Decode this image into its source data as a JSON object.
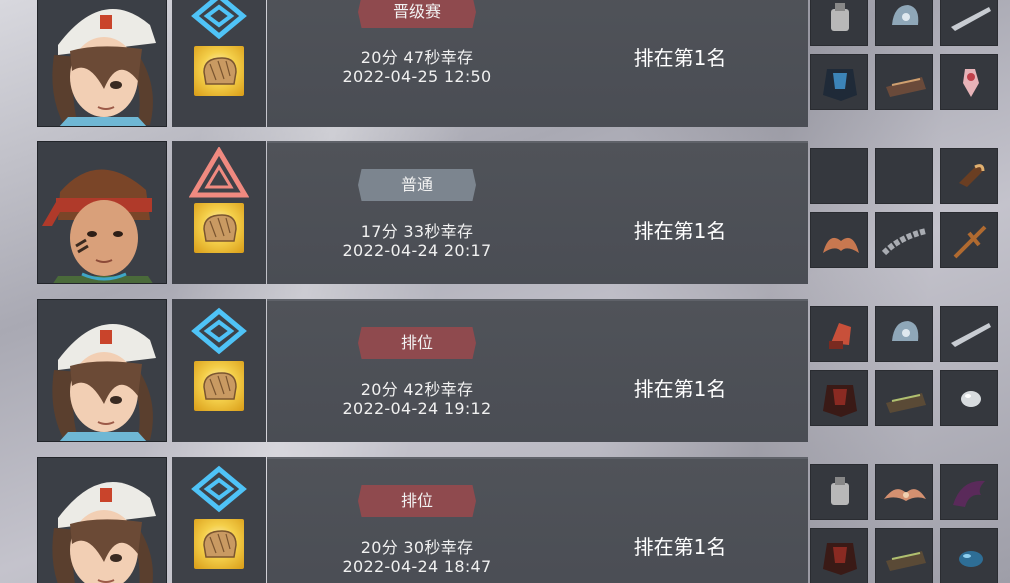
{
  "records": [
    {
      "character": "white-cap-hair-over-eye",
      "mode_icon": "diamond-rank-icon",
      "mode_color": "#4fc3f7",
      "tag": "晋级赛",
      "tag_color": "#8f4a4e",
      "survival": "20分 47秒幸存",
      "date": "2022-04-25 12:50",
      "rank": "排在第1名",
      "items": [
        "glove-icon",
        "helmet-icon",
        "blade-icon",
        "armor-icon",
        "boots-icon",
        "trinket-icon"
      ]
    },
    {
      "character": "red-headband-boy",
      "mode_icon": "triangle-normal-icon",
      "mode_color": "#f08a80",
      "tag": "普通",
      "tag_color": "#7c858f",
      "survival": "17分 33秒幸存",
      "date": "2022-04-24 20:17",
      "rank": "排在第1名",
      "items": [
        "",
        "",
        "bullet-icon",
        "horns-icon",
        "chain-icon",
        "cross-staff-icon"
      ]
    },
    {
      "character": "white-cap-hair-over-eye",
      "mode_icon": "diamond-rank-icon",
      "mode_color": "#4fc3f7",
      "tag": "排位",
      "tag_color": "#8f4a4e",
      "survival": "20分 42秒幸存",
      "date": "2022-04-24 19:12",
      "rank": "排在第1名",
      "items": [
        "fist-icon",
        "helmet-icon",
        "blade-icon",
        "armor-icon",
        "boots-icon",
        "orb-icon"
      ]
    },
    {
      "character": "white-cap-hair-over-eye",
      "mode_icon": "diamond-rank-icon",
      "mode_color": "#4fc3f7",
      "tag": "排位",
      "tag_color": "#8f4a4e",
      "survival": "20分 30秒幸存",
      "date": "2022-04-24 18:47",
      "rank": "排在第1名",
      "items": [
        "glove-icon",
        "wings-icon",
        "claw-icon",
        "armor-icon",
        "boots-icon",
        "gem-icon"
      ]
    }
  ]
}
